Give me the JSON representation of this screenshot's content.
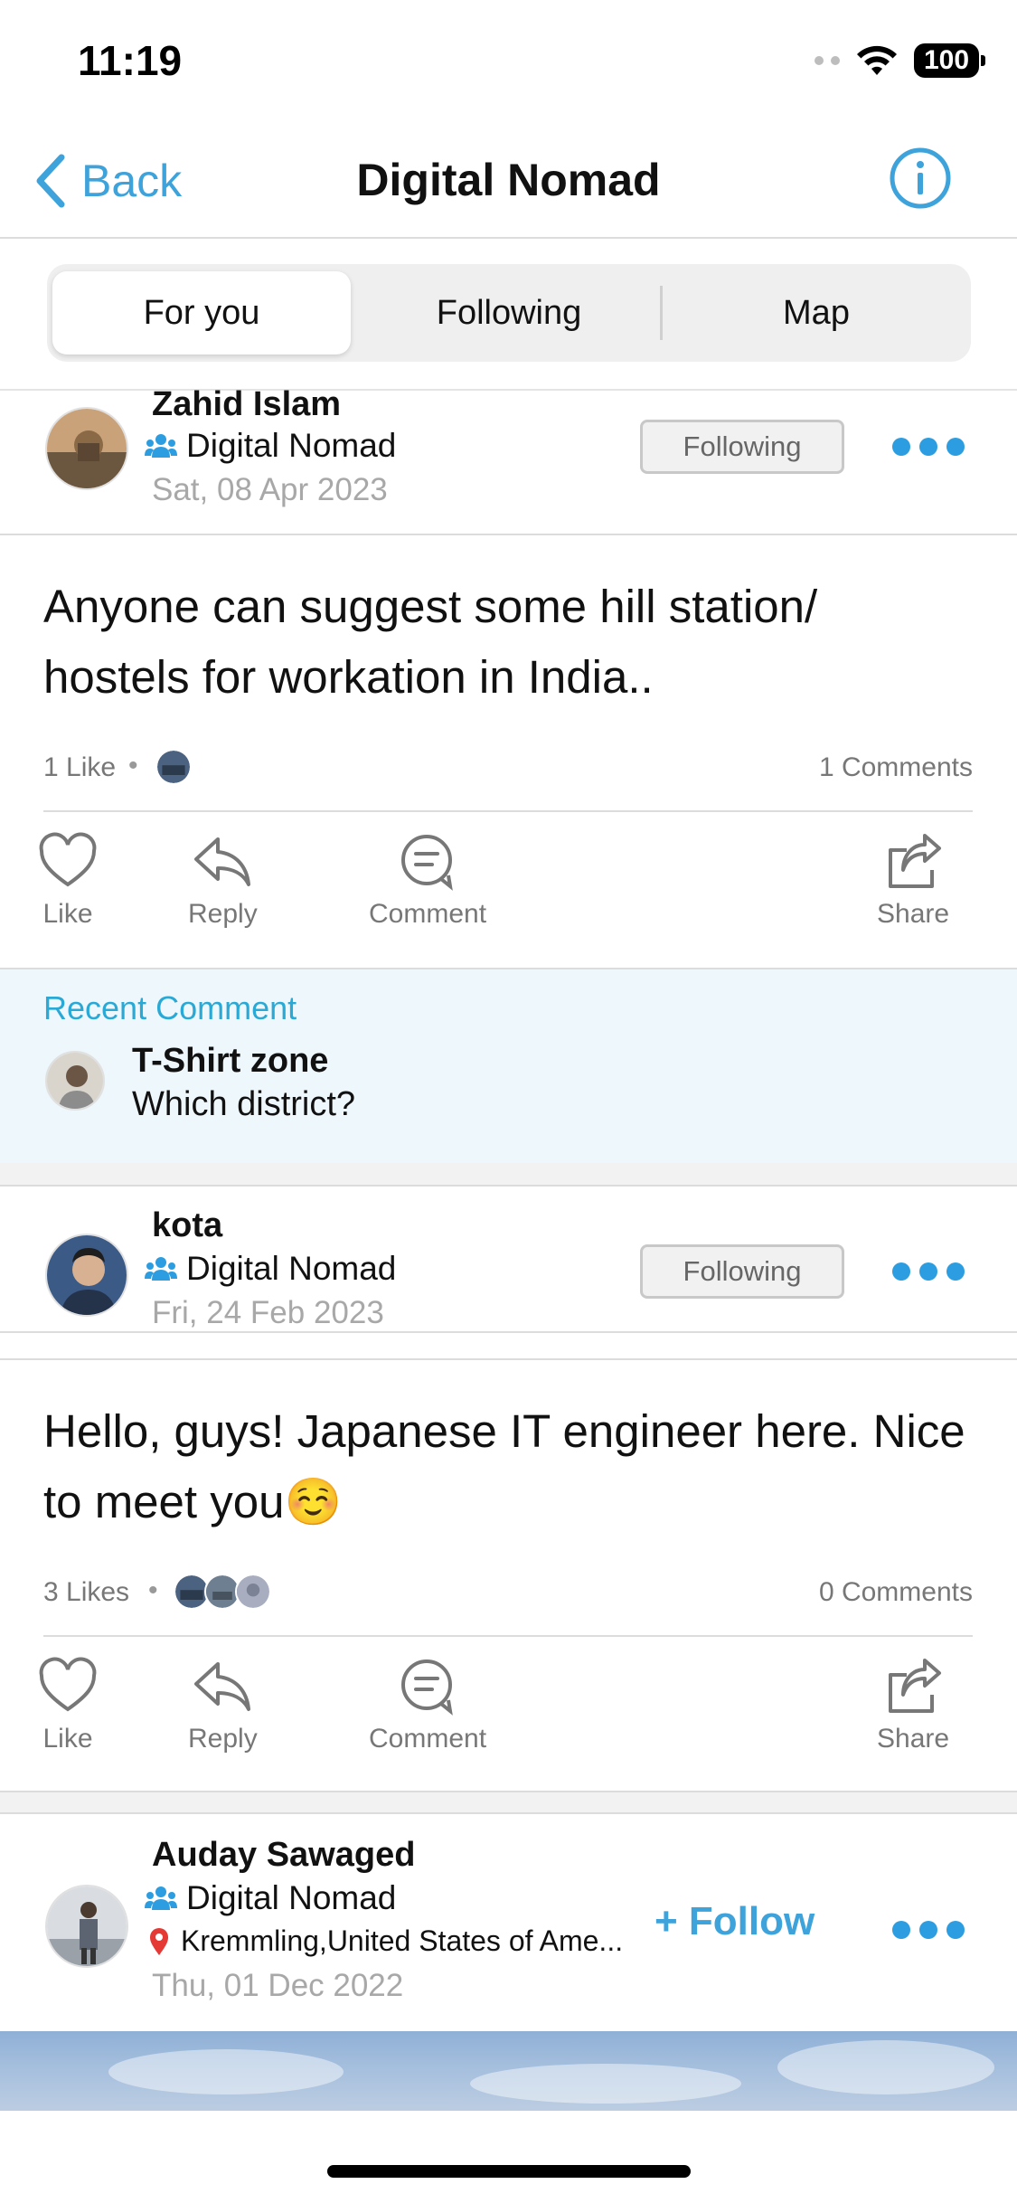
{
  "status_bar": {
    "time": "11:19",
    "battery": "100"
  },
  "nav": {
    "back_label": "Back",
    "title": "Digital Nomad"
  },
  "tabs": [
    {
      "label": "For you",
      "active": true
    },
    {
      "label": "Following",
      "active": false
    },
    {
      "label": "Map",
      "active": false
    }
  ],
  "actions": {
    "like": "Like",
    "reply": "Reply",
    "comment": "Comment",
    "share": "Share"
  },
  "posts": [
    {
      "author": "Zahid Islam",
      "group": "Digital Nomad",
      "date": "Sat, 08 Apr 2023",
      "relationship": "Following",
      "body": "Anyone can suggest some hill station/ hostels for workation in India..",
      "likes": "1 Like",
      "comments": "1 Comments",
      "recent_comment": {
        "title": "Recent Comment",
        "author": "T-Shirt zone",
        "text": "Which district?"
      }
    },
    {
      "author": "kota",
      "group": "Digital Nomad",
      "date": "Fri, 24 Feb 2023",
      "relationship": "Following",
      "body": "Hello, guys! Japanese IT engineer here. Nice to meet you☺️",
      "likes": "3 Likes",
      "comments": "0 Comments"
    },
    {
      "author": "Auday Sawaged",
      "group": "Digital Nomad",
      "location": "Kremmling,United States of Ame...",
      "date": "Thu, 01 Dec 2022",
      "follow_label": "+ Follow"
    }
  ],
  "colors": {
    "accent": "#3ea2db",
    "dots": "#2b9de0",
    "recent_comment_bg": "#eef7fc",
    "recent_comment_title": "#29a9d6",
    "location_pin": "#e53935"
  }
}
